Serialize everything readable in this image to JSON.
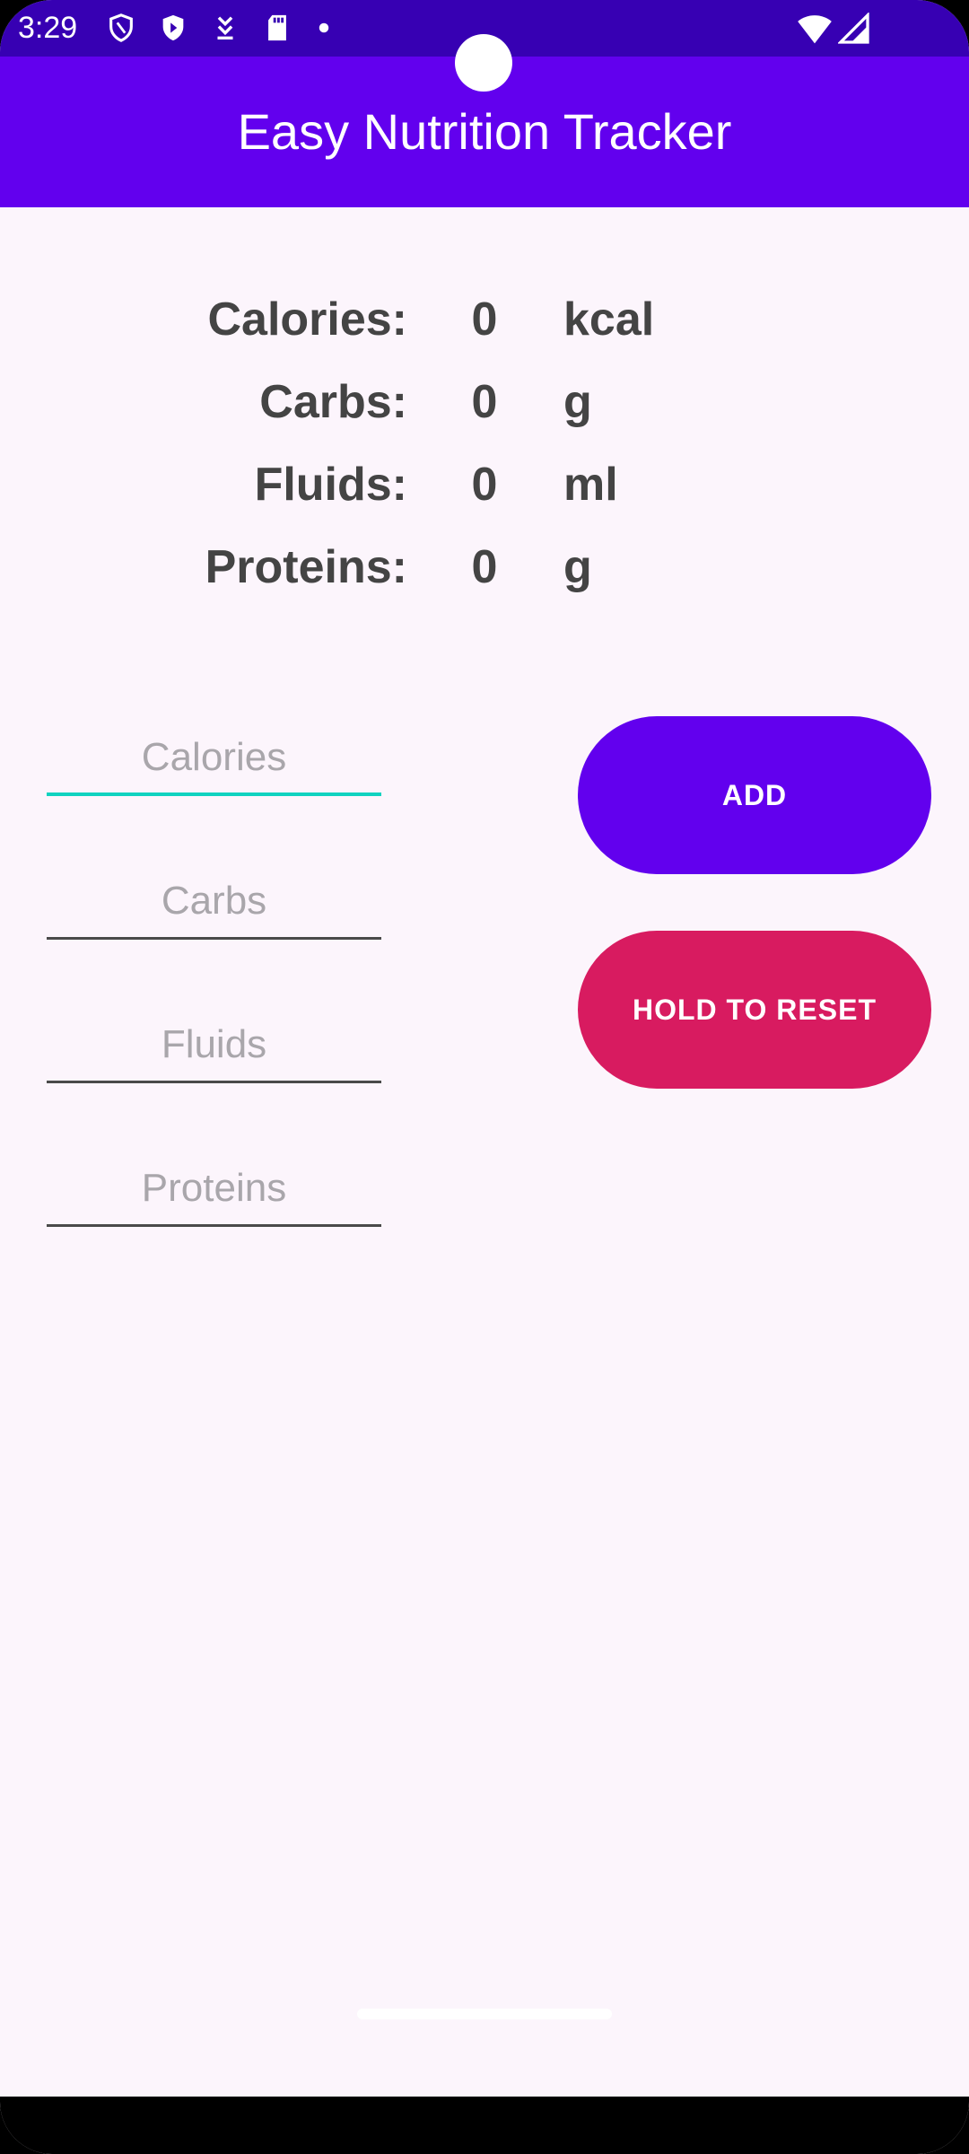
{
  "status_bar": {
    "time": "3:29",
    "icons_left": [
      "shield-outline-icon",
      "shield-play-icon",
      "download-arrow-icon",
      "sd-card-icon",
      "dot-icon"
    ],
    "icons_right": [
      "wifi-icon",
      "signal-icon"
    ]
  },
  "app_bar": {
    "title": "Easy Nutrition Tracker"
  },
  "summary": {
    "rows": [
      {
        "label": "Calories:",
        "value": "0",
        "unit": "kcal"
      },
      {
        "label": "Carbs:",
        "value": "0",
        "unit": "g"
      },
      {
        "label": "Fluids:",
        "value": "0",
        "unit": "ml"
      },
      {
        "label": "Proteins:",
        "value": "0",
        "unit": "g"
      }
    ]
  },
  "inputs": {
    "calories": {
      "placeholder": "Calories",
      "value": ""
    },
    "carbs": {
      "placeholder": "Carbs",
      "value": ""
    },
    "fluids": {
      "placeholder": "Fluids",
      "value": ""
    },
    "proteins": {
      "placeholder": "Proteins",
      "value": ""
    }
  },
  "buttons": {
    "add_label": "ADD",
    "reset_label": "HOLD TO RESET"
  },
  "colors": {
    "status_bar": "#3700b3",
    "app_bar": "#6200ee",
    "add_button": "#6200ee",
    "reset_button": "#d81b60",
    "focused_underline": "#10d3c0",
    "background": "#fcf5fc"
  }
}
